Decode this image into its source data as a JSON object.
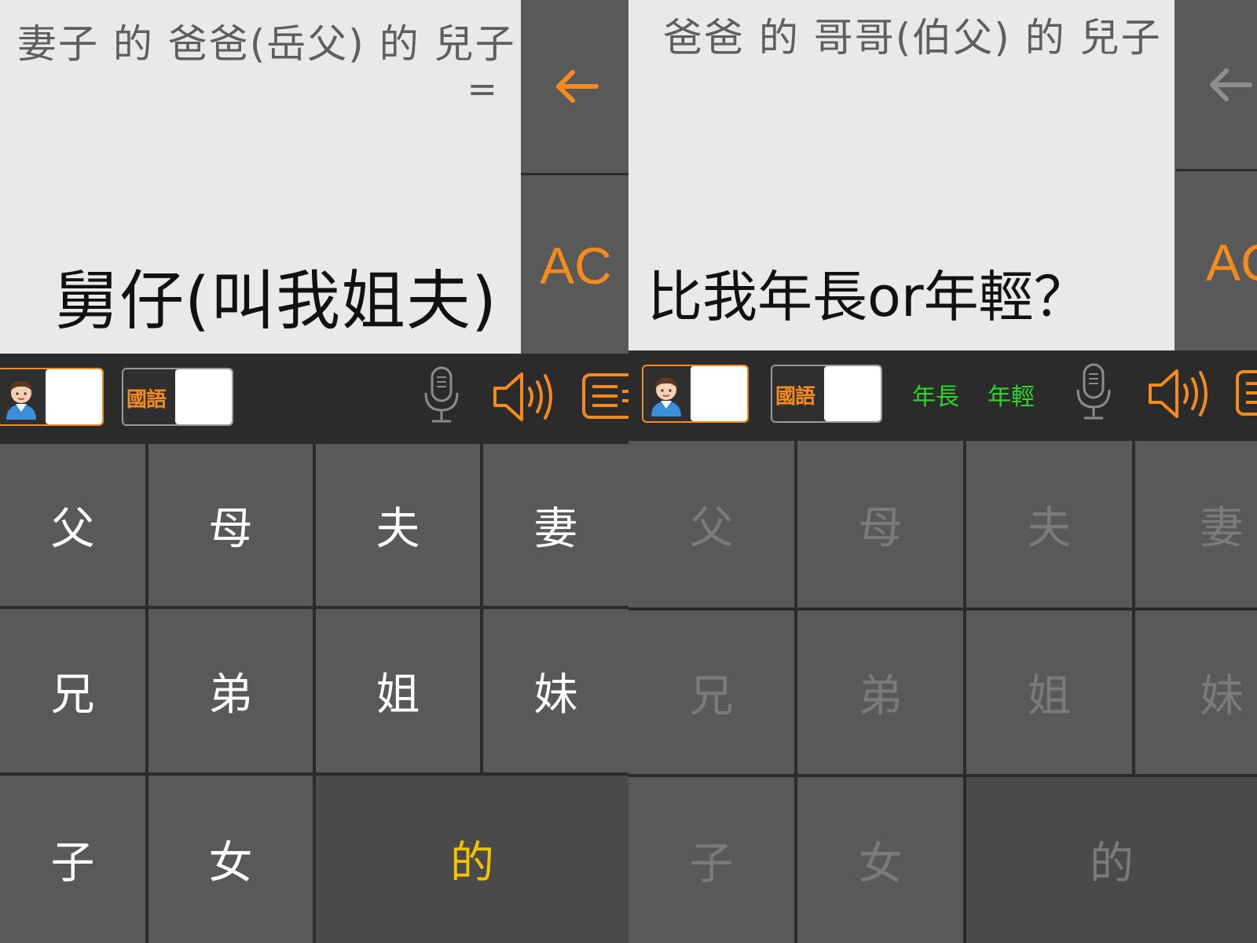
{
  "left": {
    "expression": "妻子 的 爸爸(岳父) 的 兒子",
    "equals": "=",
    "result": "舅仔(叫我姐夫)",
    "back_label": "←",
    "ac_label": "AC",
    "lang_label": "國語",
    "keys": [
      "父",
      "母",
      "夫",
      "妻",
      "兄",
      "弟",
      "姐",
      "妹",
      "子",
      "女",
      "的"
    ]
  },
  "right": {
    "expression": "爸爸 的 哥哥(伯父) 的 兒子",
    "question": "比我年長or年輕？",
    "back_label": "←",
    "ac_label": "AC",
    "lang_label": "國語",
    "older_label": "年長",
    "younger_label": "年輕",
    "keys": [
      "父",
      "母",
      "夫",
      "妻",
      "兄",
      "弟",
      "姐",
      "妹",
      "子",
      "女",
      "的"
    ]
  },
  "colors": {
    "accent_orange": "#f58a1f",
    "key_gray": "#595959",
    "display_bg": "#e9e9e9",
    "age_green": "#2cd42c",
    "de_yellow": "#f5c200"
  },
  "icons": [
    "back-arrow-icon",
    "microphone-icon",
    "speaker-icon",
    "menu-icon",
    "avatar-icon"
  ]
}
